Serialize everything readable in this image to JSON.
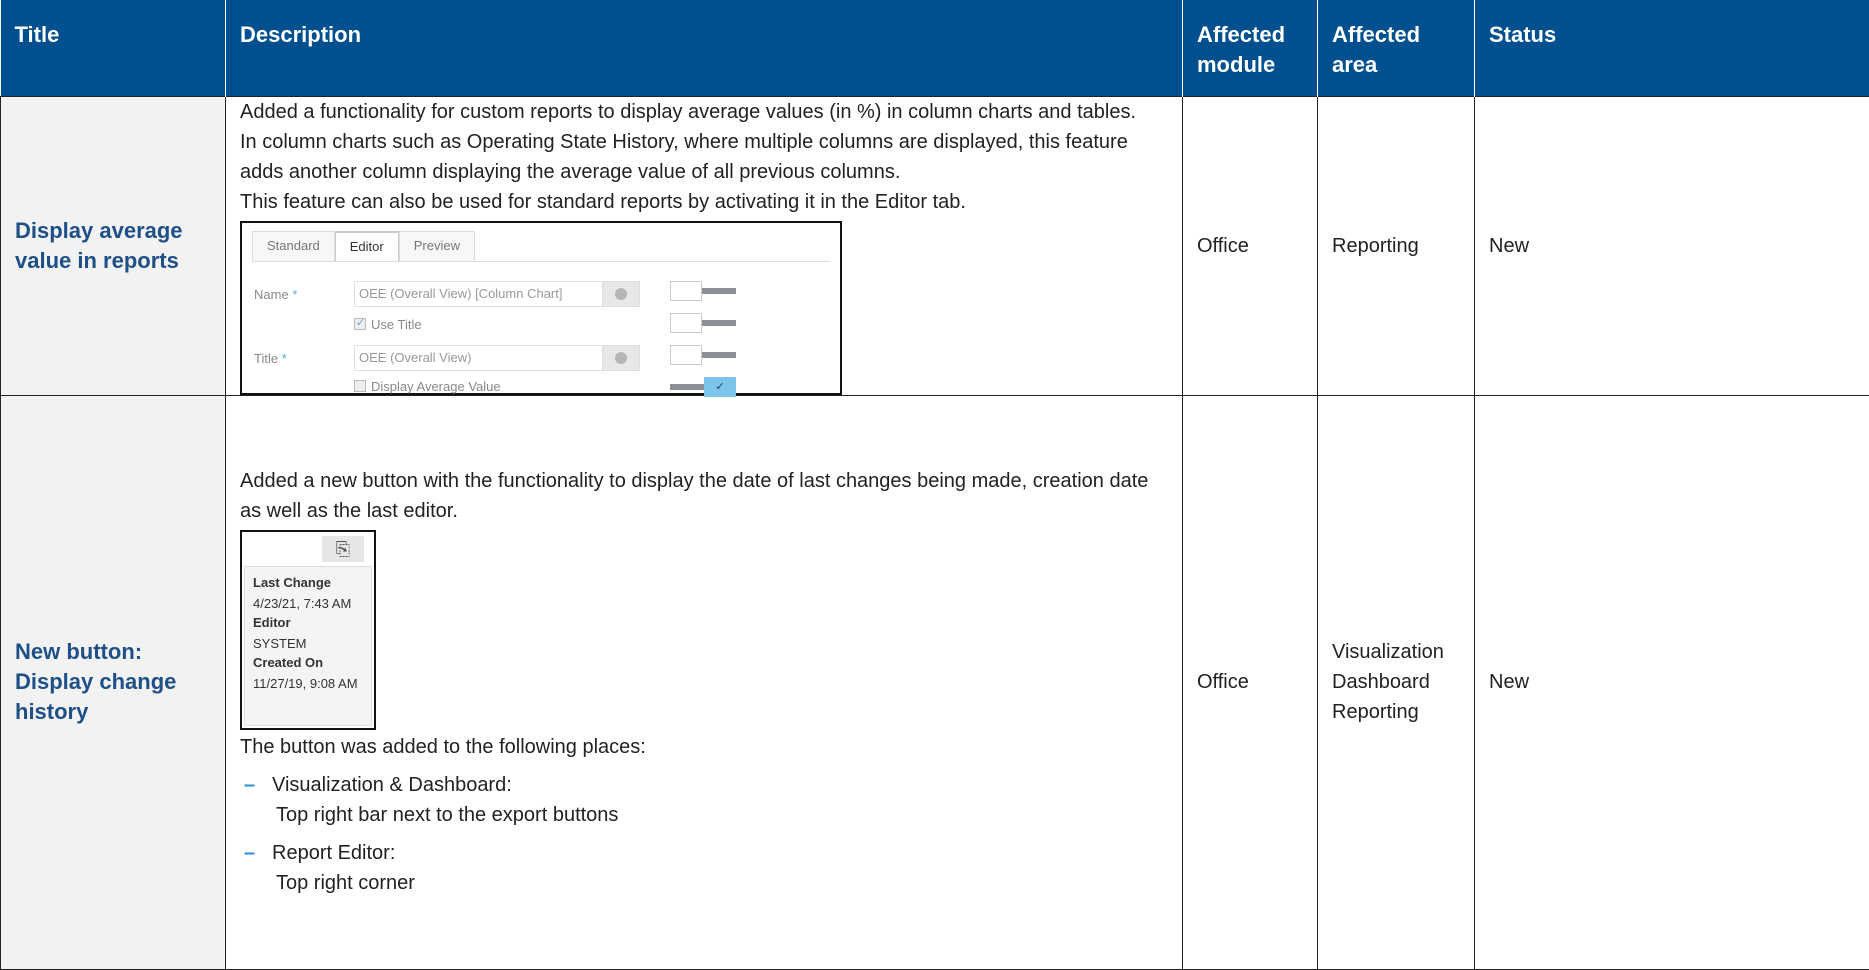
{
  "header": {
    "title": "Title",
    "description": "Description",
    "affected_module": "Affected module",
    "affected_area": "Affected area",
    "status": "Status"
  },
  "rows": [
    {
      "title": "Display average value in reports",
      "description": [
        "Added a functionality for custom reports to display average values (in %) in column charts and tables.",
        "In column charts such as Operating State History, where multiple columns are displayed, this feature adds another column displaying the average value of all previous columns.",
        "This feature can also be used for standard reports by activating it in the Editor tab."
      ],
      "editor": {
        "tabs": [
          "Standard",
          "Editor",
          "Preview"
        ],
        "name_label": "Name",
        "name_value": "OEE (Overall View) [Column Chart]",
        "use_title": "Use Title",
        "title_label": "Title",
        "title_value": "OEE (Overall View)",
        "display_average": "Display Average Value",
        "required_mark": "*",
        "accent_color": "#5aa9e0"
      },
      "module": "Office",
      "area": "Reporting",
      "status": "New"
    },
    {
      "title": "New button: Display change history",
      "description": [
        "Added a new button with the functionality to display the date of last changes being made, creation date as well as the last editor.",
        "The button was added to the following places:"
      ],
      "history": {
        "last_change_label": "Last Change",
        "last_change_value": "4/23/21, 7:43 AM",
        "editor_label": "Editor",
        "editor_value": "SYSTEM",
        "created_label": "Created On",
        "created_value": "11/27/19, 9:08 AM"
      },
      "bullets": [
        {
          "title": "Visualization & Dashboard:",
          "detail": "Top right bar next to the export buttons"
        },
        {
          "title": "Report Editor:",
          "detail": "Top right corner"
        }
      ],
      "module": "Office",
      "area": [
        "Visualization",
        "Dashboard",
        "Reporting"
      ],
      "status": "New"
    }
  ],
  "colors": {
    "header_bg": "#00508f",
    "title_text": "#1e4f86",
    "title_bg": "#f2f2f2",
    "bullet": "#2a8fd6"
  }
}
